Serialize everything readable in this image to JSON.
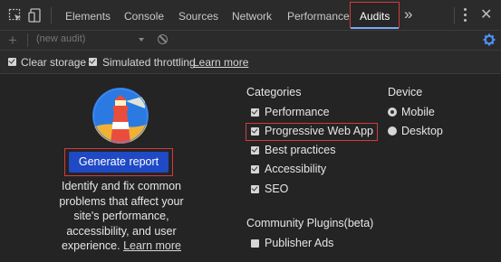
{
  "tabs": {
    "items": [
      "Elements",
      "Console",
      "Sources",
      "Network",
      "Performance",
      "Audits"
    ],
    "overflow": "»"
  },
  "toolbar": {
    "audit_select": "(new audit)"
  },
  "options": {
    "clear_storage": {
      "label": "Clear storage",
      "checked": true
    },
    "throttling": {
      "label": "Simulated throttling",
      "checked": true
    },
    "learn_more": "Learn more"
  },
  "main": {
    "generate_button": "Generate report",
    "description": "Identify and fix common problems that affect your site's performance, accessibility, and user experience.",
    "learn_more": "Learn more"
  },
  "categories": {
    "heading": "Categories",
    "items": [
      {
        "label": "Performance",
        "checked": true
      },
      {
        "label": "Progressive Web App",
        "checked": true
      },
      {
        "label": "Best practices",
        "checked": true
      },
      {
        "label": "Accessibility",
        "checked": true
      },
      {
        "label": "SEO",
        "checked": true
      }
    ]
  },
  "device": {
    "heading": "Device",
    "options": [
      {
        "label": "Mobile",
        "selected": true
      },
      {
        "label": "Desktop",
        "selected": false
      }
    ]
  },
  "plugins": {
    "heading": "Community Plugins(beta)",
    "items": [
      {
        "label": "Publisher Ads",
        "checked": false
      }
    ]
  },
  "colors": {
    "background": "#242424",
    "toolbar": "#2b2b2b",
    "button": "#1f49c5",
    "highlight_border": "#d33b3b",
    "active_tab_underline": "#7aa8f0",
    "settings_icon": "#4f8ff7"
  },
  "icons": [
    "inspect-element-icon",
    "device-toggle-icon",
    "more-tabs-icon",
    "kebab-menu-icon",
    "close-icon",
    "add-audit-icon",
    "dropdown-caret-icon",
    "clear-icon",
    "settings-gear-icon",
    "lighthouse-logo-icon"
  ]
}
